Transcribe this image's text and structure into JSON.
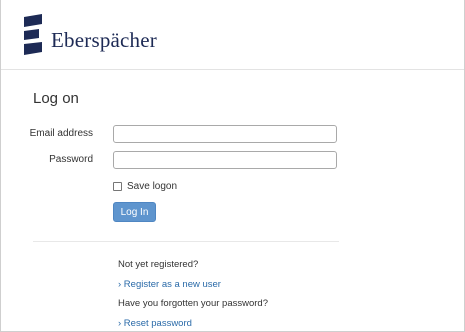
{
  "header": {
    "brand_name": "Eberspächer",
    "brand_color": "#1d2a55"
  },
  "main": {
    "title": "Log on",
    "email_label": "Email address",
    "email_value": "",
    "password_label": "Password",
    "password_value": "",
    "save_logon_label": "Save logon",
    "save_logon_checked": false,
    "login_button_label": "Log In",
    "accent_color": "#5f95ce"
  },
  "register": {
    "question": "Not yet registered?",
    "link": "› Register as a new user"
  },
  "forgot": {
    "question": "Have you forgotten your password?",
    "link": "› Reset password"
  }
}
